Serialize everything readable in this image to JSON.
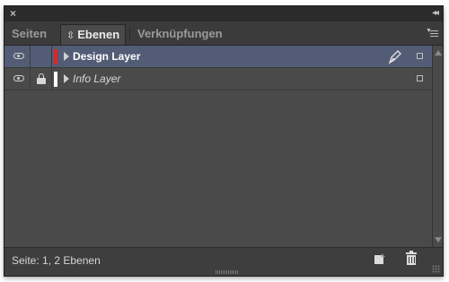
{
  "panel": {
    "close_glyph": "×",
    "collapse_glyph": "◂◂"
  },
  "tabs": [
    {
      "label": "Seiten",
      "active": false
    },
    {
      "label": "Ebenen",
      "active": true,
      "prefix": "⇳"
    },
    {
      "label": "Verknüpfungen",
      "active": false
    }
  ],
  "layers": [
    {
      "name": "Design Layer",
      "visible": true,
      "locked": false,
      "color": "#e02424",
      "selected": true,
      "style": "bold",
      "icons": [
        "eye-icon",
        "disclosure-arrow-icon",
        "pen-icon",
        "selection-square-icon"
      ]
    },
    {
      "name": "Info Layer",
      "visible": true,
      "locked": true,
      "color": "#ffffff",
      "selected": false,
      "style": "italic",
      "icons": [
        "eye-icon",
        "lock-icon",
        "disclosure-arrow-icon",
        "selection-square-icon"
      ]
    }
  ],
  "footer": {
    "status": "Seite: 1, 2 Ebenen"
  },
  "colors": {
    "panel_bg": "#4a4a4a",
    "selection": "#525d75",
    "titlebar": "#2b2b2b"
  }
}
